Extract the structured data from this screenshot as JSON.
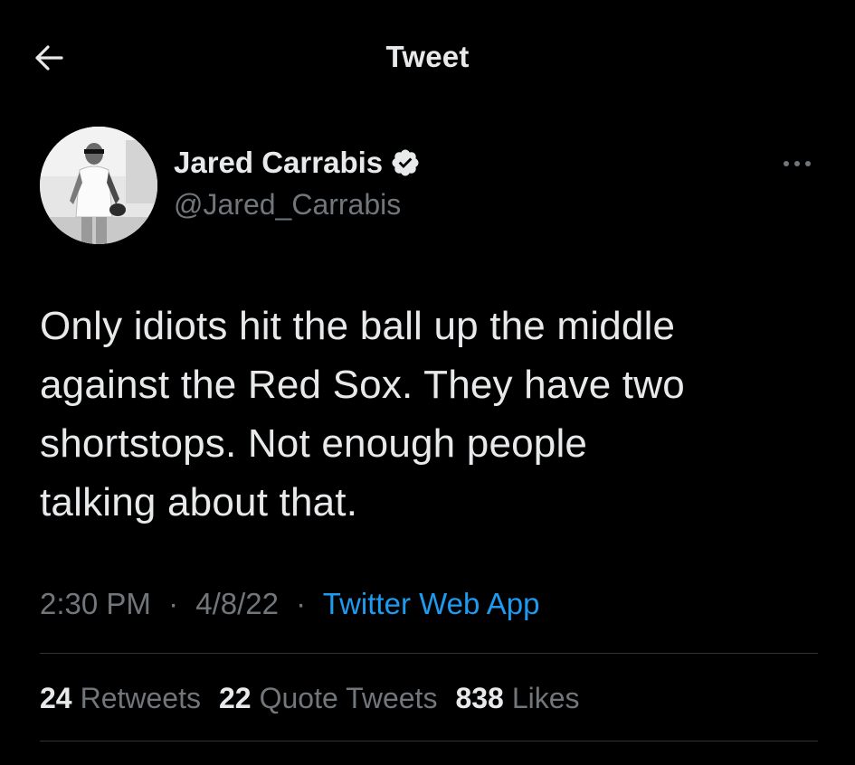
{
  "header": {
    "title": "Tweet",
    "back_icon": "arrow-left-icon"
  },
  "author": {
    "display_name": "Jared Carrabis",
    "handle": "@Jared_Carrabis",
    "verified": true,
    "verified_icon": "verified-badge-icon",
    "more_icon": "more-horizontal-icon"
  },
  "tweet": {
    "text_lines": [
      "Only idiots hit the ball up the middle",
      "against the Red Sox. They have two",
      "shortstops. Not enough people",
      "talking about that."
    ],
    "time": "2:30 PM",
    "separator": "·",
    "date": "4/8/22",
    "source": "Twitter Web App"
  },
  "stats": {
    "retweets": {
      "count": "24",
      "label": "Retweets"
    },
    "quotes": {
      "count": "22",
      "label": "Quote Tweets"
    },
    "likes": {
      "count": "838",
      "label": "Likes"
    }
  },
  "colors": {
    "background": "#000000",
    "text": "#e7e9ea",
    "secondary": "#71767b",
    "link": "#1d9bf0",
    "divider": "#2f3336"
  }
}
